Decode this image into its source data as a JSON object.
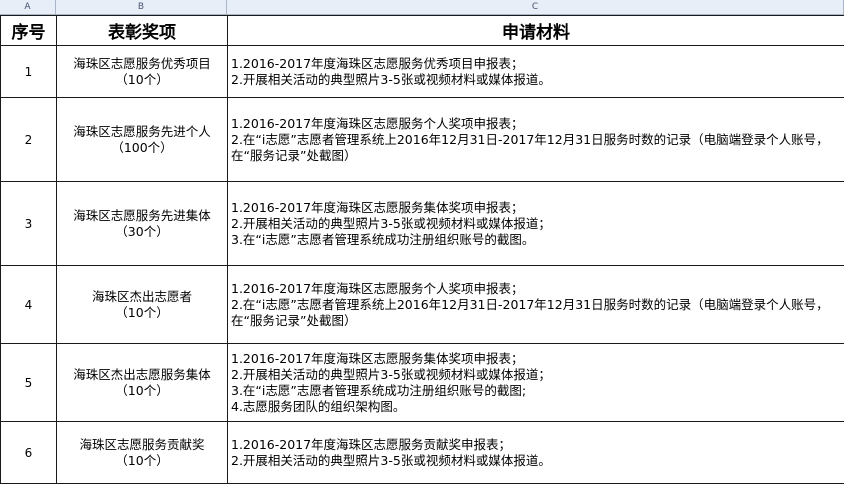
{
  "column_letters": [
    "A",
    "B",
    "C"
  ],
  "headers": {
    "no": "序号",
    "award": "表彰奖项",
    "materials": "申请材料"
  },
  "rows": [
    {
      "no": "1",
      "award": "海珠区志愿服务优秀项目",
      "count": "（10个）",
      "materials": [
        "1.2016-2017年度海珠区志愿服务优秀项目申报表；",
        "2.开展相关活动的典型照片3-5张或视频材料或媒体报道。"
      ]
    },
    {
      "no": "2",
      "award": "海珠区志愿服务先进个人",
      "count": "（100个）",
      "materials": [
        "1.2016-2017年度海珠区志愿服务个人奖项申报表；",
        "2.在“i志愿”志愿者管理系统上2016年12月31日-2017年12月31日服务时数的记录（电脑端登录个人账号，在“服务记录”处截图）"
      ]
    },
    {
      "no": "3",
      "award": "海珠区志愿服务先进集体",
      "count": "（30个）",
      "materials": [
        "1.2016-2017年度海珠区志愿服务集体奖项申报表；",
        "2.开展相关活动的典型照片3-5张或视频材料或媒体报道；",
        "3.在“i志愿”志愿者管理系统成功注册组织账号的截图。"
      ]
    },
    {
      "no": "4",
      "award": "海珠区杰出志愿者",
      "count": "（10个）",
      "materials": [
        "1.2016-2017年度海珠区志愿服务个人奖项申报表；",
        "2.在“i志愿”志愿者管理系统上2016年12月31日-2017年12月31日服务时数的记录（电脑端登录个人账号，在“服务记录”处截图）"
      ]
    },
    {
      "no": "5",
      "award": "海珠区杰出志愿服务集体",
      "count": "（10个）",
      "materials": [
        "1.2016-2017年度海珠区志愿服务集体奖项申报表；",
        "2.开展相关活动的典型照片3-5张或视频材料或媒体报道；",
        "3.在“i志愿”志愿者管理系统成功注册组织账号的截图;",
        "4.志愿服务团队的组织架构图。"
      ]
    },
    {
      "no": "6",
      "award": "海珠区志愿服务贡献奖",
      "count": "（10个）",
      "materials": [
        "1.2016-2017年度海珠区志愿服务贡献奖申报表；",
        "2.开展相关活动的典型照片3-5张或视频材料或媒体报道。"
      ]
    }
  ]
}
